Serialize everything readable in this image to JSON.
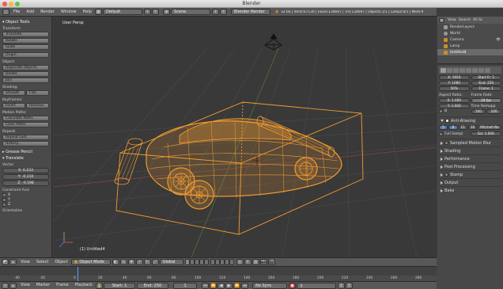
{
  "window": {
    "title": "Blender"
  },
  "info_header": {
    "menus": [
      "File",
      "Add",
      "Render",
      "Window",
      "Help"
    ],
    "layout": "Default",
    "scene": "Scene",
    "engine": "Blender Render",
    "stats": "v2.66 | Verts:67130 | Faces:134697 | Tris:134697 | Objects:1/1 | Lamps:0/1 | Mem:90.31M | Untitled"
  },
  "tool_shelf": {
    "title": "Object Tools",
    "groups": [
      {
        "label": "Transform:",
        "buttons": [
          "Translate",
          "Rotate",
          "Scale"
        ]
      },
      {
        "label": "",
        "buttons": [
          "Origin"
        ]
      },
      {
        "label": "Object:",
        "buttons": [
          "Duplicate Objects",
          "Delete",
          "Join"
        ]
      },
      {
        "label": "Shading:",
        "pairs": [
          [
            "Smooth",
            "Flat"
          ]
        ]
      },
      {
        "label": "Keyframes:",
        "pairs": [
          [
            "Insert",
            "Remove"
          ]
        ]
      },
      {
        "label": "Motion Paths:",
        "buttons": [
          "Calculate Paths",
          "Clear Paths"
        ]
      },
      {
        "label": "Repeat:",
        "buttons": [
          "Repeat Last",
          "History..."
        ]
      }
    ],
    "grease_pencil": "Grease Pencil",
    "operator": {
      "title": "Translate",
      "vector_label": "Vector",
      "x": "X: 0.233",
      "y": "Y: -0.210",
      "z": "Z: -0.598",
      "constraint_label": "Constraint Axis",
      "axes": [
        "X",
        "Y",
        "Z"
      ],
      "orientation_label": "Orientation"
    }
  },
  "viewport": {
    "label": "User Persp",
    "object_label": "(1) Untitled4"
  },
  "outliner": {
    "header": [
      "View",
      "Search",
      "All Sc"
    ],
    "items": [
      {
        "name": "RenderLayers",
        "color": "#9a9a9a"
      },
      {
        "name": "World",
        "color": "#9a9a9a"
      },
      {
        "name": "Camera",
        "color": "#c98c2c"
      },
      {
        "name": "Lamp",
        "color": "#c98c2c"
      },
      {
        "name": "Untitled4",
        "color": "#c98c2c"
      }
    ]
  },
  "properties": {
    "resolution_x": "X: 1920",
    "resolution_y": "Y: 1080",
    "resolution_pct": "50%",
    "start_frame": "Start Fr: 1",
    "end_frame": "End: 250",
    "frame": "Frame: 1",
    "aspect_label": "Aspect Ratio:",
    "frame_rate_label": "Frame Rate:",
    "aspect_x": "X: 1.000",
    "aspect_y": "Y: 1.000",
    "fps": "24 fps",
    "time_remap": "Time Remapp",
    "remap_old": "100",
    "remap_new": "100",
    "border_label": "B",
    "antialiasing": "Anti-Aliasing",
    "aa_samples": [
      "5",
      "8",
      "11",
      "16"
    ],
    "aa_filter": "Mitchell-Ne",
    "full_sample": "Full Sampl",
    "filter_size": "Siz: 1.000",
    "panels": [
      "Sampled Motion Blur",
      "Shading",
      "Performance",
      "Post Processing",
      "Stamp",
      "Output",
      "Bake"
    ]
  },
  "v3d_header": {
    "view": "View",
    "select": "Select",
    "object": "Object",
    "mode": "Object Mode",
    "orientation": "Global"
  },
  "timeline": {
    "ticks": [
      "-40",
      "-20",
      "0",
      "20",
      "40",
      "60",
      "80",
      "100",
      "120",
      "140",
      "160",
      "180",
      "200",
      "220",
      "240",
      "260",
      "280"
    ],
    "view": "View",
    "marker": "Marker",
    "frame": "Frame",
    "playback": "Playback",
    "start": "Start: 1",
    "end": "End: 250",
    "current": "1",
    "sync": "No Sync"
  },
  "colors": {
    "accent": "#f0a030",
    "wire": "#f29b30",
    "bg": "#393939"
  }
}
